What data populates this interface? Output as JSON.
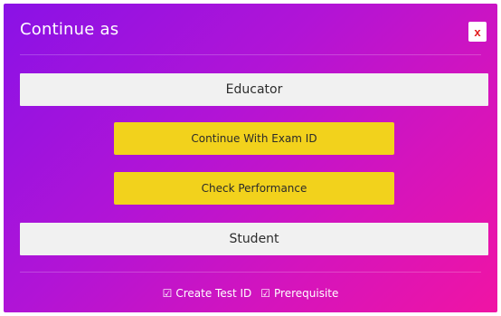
{
  "modal": {
    "title": "Continue as",
    "close_label": "x"
  },
  "buttons": {
    "educator": "Educator",
    "continue_exam": "Continue With Exam ID",
    "check_performance": "Check Performance",
    "student": "Student"
  },
  "footer": {
    "items": [
      {
        "icon": "checkbox-checked-icon",
        "glyph": "☑",
        "label": "Create Test ID"
      },
      {
        "icon": "checkbox-checked-icon",
        "glyph": "☑",
        "label": "Prerequisite"
      }
    ]
  },
  "colors": {
    "gradient_start": "#8a12e6",
    "gradient_end": "#f014a4",
    "action_button": "#f2d21c",
    "role_button": "#f1f1f1",
    "close_x": "#e21c1c"
  }
}
